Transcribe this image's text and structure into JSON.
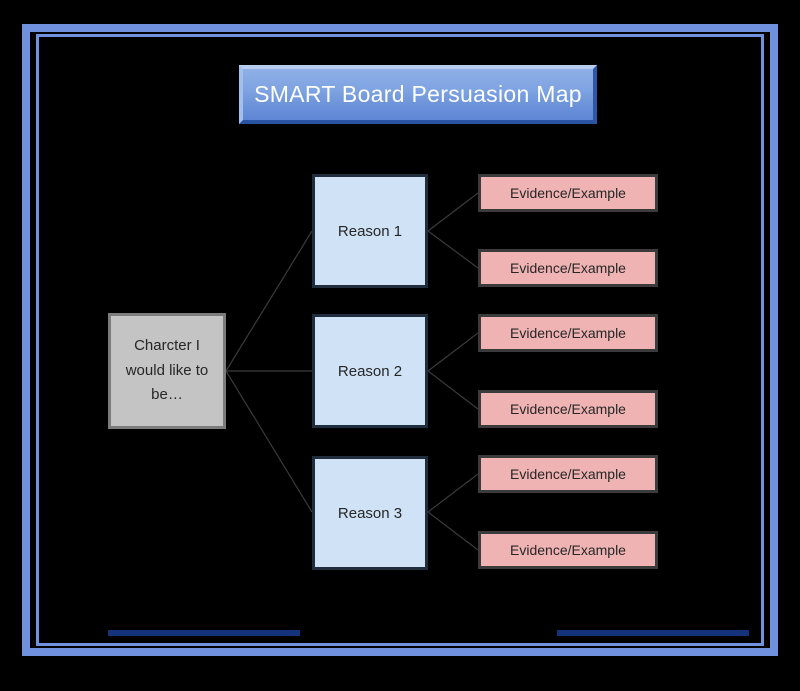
{
  "slide": {
    "title": "SMART Board Persuasion Map",
    "background_color": "#000000",
    "frame_color": "#6f91de",
    "accent_bar_color": "#14337a"
  },
  "central_node": {
    "label": "Charcter I would like to be…",
    "fill": "#c4c4c4",
    "border": "#7c7c7c"
  },
  "reasons": [
    {
      "label": "Reason 1",
      "evidence": [
        {
          "label": "Evidence/Example"
        },
        {
          "label": "Evidence/Example"
        }
      ]
    },
    {
      "label": "Reason 2",
      "evidence": [
        {
          "label": "Evidence/Example"
        },
        {
          "label": "Evidence/Example"
        }
      ]
    },
    {
      "label": "Reason 3",
      "evidence": [
        {
          "label": "Evidence/Example"
        },
        {
          "label": "Evidence/Example"
        }
      ]
    }
  ],
  "colors": {
    "reason_fill": "#cfe2f6",
    "reason_border": "#1f2d3d",
    "evidence_fill": "#f0b3b3",
    "evidence_border": "#3b3b3b",
    "title_text": "#ffffff",
    "connector": "#3a3a3a"
  }
}
